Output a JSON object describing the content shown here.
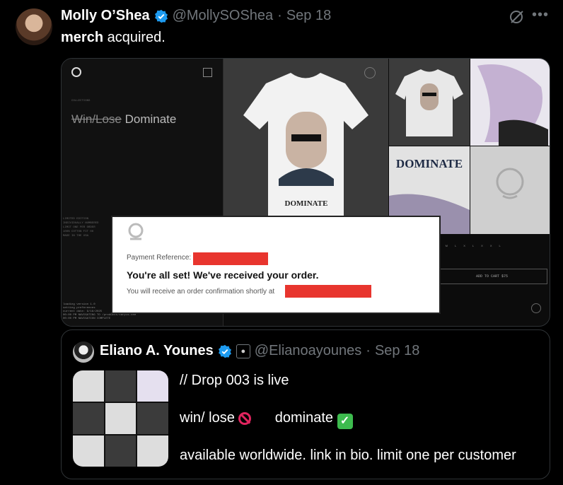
{
  "tweet": {
    "display_name": "Molly O’Shea",
    "handle": "@MollySOShea",
    "separator": "·",
    "date": "Sep 18",
    "text_bold": "merch",
    "text_rest": " acquired."
  },
  "media": {
    "collections_label": "COLLECTIONS",
    "title_strike": "Win/Lose",
    "title_rest": " Dominate",
    "limited_text": "LIMITED EDITION\nINDIVIDUALLY NUMBERED\nLIMIT ONE PER ORDER\n100% COTTON FIT 00\nMADE IN THE USA",
    "console_text": "loading version 1.0\nsetting preferences\ncurrent date: 9/18/2025\n00:00 PM NAVIGATING TO /products/tarpis-tee\n00:00 PM NAVIGATION COMPLETE",
    "sizes": [
      "S",
      "M",
      "L",
      "XL",
      "XXL"
    ],
    "add_to_cart": "ADD TO CART $75",
    "shirt_text": "DOMINATE"
  },
  "receipt": {
    "payment_ref_label": "Payment Reference:",
    "headline": "You're all set! We've received your order.",
    "confirmation": "You will receive an order confirmation shortly at"
  },
  "quote": {
    "display_name": "Eliano A. Younes",
    "handle": "@Elianoayounes",
    "separator": "·",
    "date": "Sep 18",
    "line1": "// Drop 003 is live",
    "line2_a": "win/ lose ",
    "line2_b": "dominate ",
    "line3": "available worldwide. link in bio. limit one per customer"
  },
  "colors": {
    "verified": "#1d9bf0",
    "redaction": "#e8352e",
    "muted": "#71767b"
  }
}
